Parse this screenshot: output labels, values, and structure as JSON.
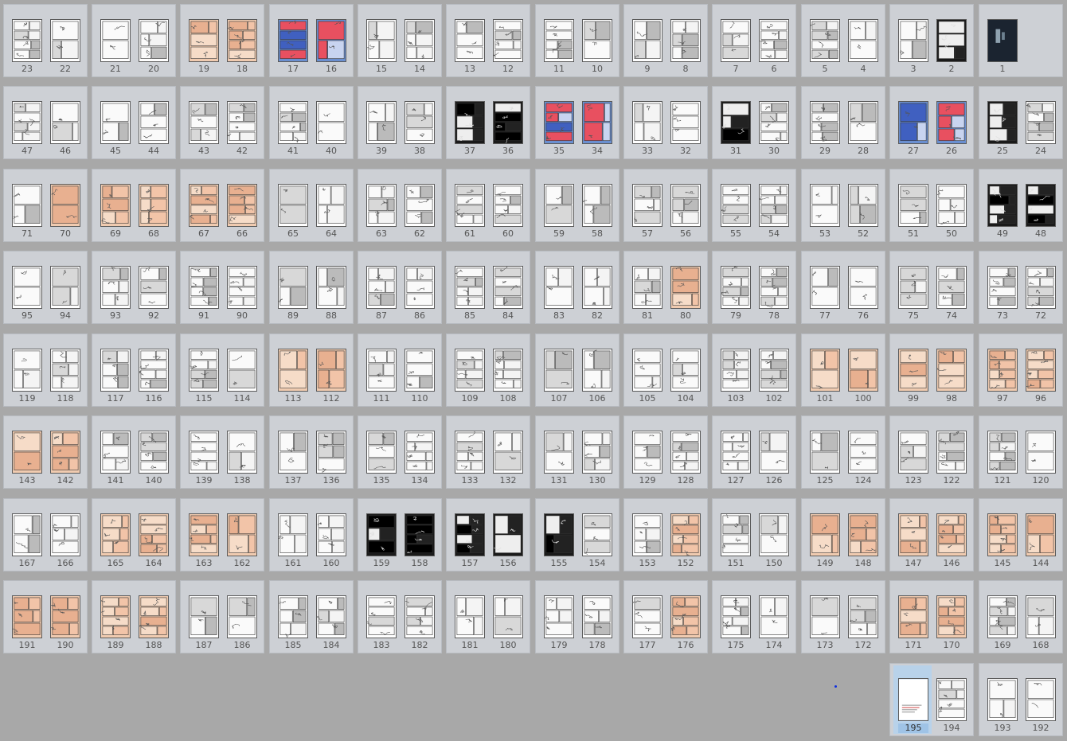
{
  "rows": [
    [
      [
        23,
        22
      ],
      [
        21,
        20
      ],
      [
        19,
        18
      ],
      [
        17,
        16
      ],
      [
        15,
        14
      ],
      [
        13,
        12
      ],
      [
        11,
        10
      ],
      [
        9,
        8
      ],
      [
        7,
        6
      ],
      [
        5,
        4
      ],
      [
        3,
        2
      ],
      [
        1
      ]
    ],
    [
      [
        47,
        46
      ],
      [
        45,
        44
      ],
      [
        43,
        42
      ],
      [
        41,
        40
      ],
      [
        39,
        38
      ],
      [
        37,
        36
      ],
      [
        35,
        34
      ],
      [
        33,
        32
      ],
      [
        31,
        30
      ],
      [
        29,
        28
      ],
      [
        27,
        26
      ],
      [
        25,
        24
      ]
    ],
    [
      [
        71,
        70
      ],
      [
        69,
        68
      ],
      [
        67,
        66
      ],
      [
        65,
        64
      ],
      [
        63,
        62
      ],
      [
        61,
        60
      ],
      [
        59,
        58
      ],
      [
        57,
        56
      ],
      [
        55,
        54
      ],
      [
        53,
        52
      ],
      [
        51,
        50
      ],
      [
        49,
        48
      ]
    ],
    [
      [
        95,
        94
      ],
      [
        93,
        92
      ],
      [
        91,
        90
      ],
      [
        89,
        88
      ],
      [
        87,
        86
      ],
      [
        85,
        84
      ],
      [
        83,
        82
      ],
      [
        81,
        80
      ],
      [
        79,
        78
      ],
      [
        77,
        76
      ],
      [
        75,
        74
      ],
      [
        73,
        72
      ]
    ],
    [
      [
        119,
        118
      ],
      [
        117,
        116
      ],
      [
        115,
        114
      ],
      [
        113,
        112
      ],
      [
        111,
        110
      ],
      [
        109,
        108
      ],
      [
        107,
        106
      ],
      [
        105,
        104
      ],
      [
        103,
        102
      ],
      [
        101,
        100
      ],
      [
        99,
        98
      ],
      [
        97,
        96
      ]
    ],
    [
      [
        143,
        142
      ],
      [
        141,
        140
      ],
      [
        139,
        138
      ],
      [
        137,
        136
      ],
      [
        135,
        134
      ],
      [
        133,
        132
      ],
      [
        131,
        130
      ],
      [
        129,
        128
      ],
      [
        127,
        126
      ],
      [
        125,
        124
      ],
      [
        123,
        122
      ],
      [
        121,
        120
      ]
    ],
    [
      [
        167,
        166
      ],
      [
        165,
        164
      ],
      [
        163,
        162
      ],
      [
        161,
        160
      ],
      [
        159,
        158
      ],
      [
        157,
        156
      ],
      [
        155,
        154
      ],
      [
        153,
        152
      ],
      [
        151,
        150
      ],
      [
        149,
        148
      ],
      [
        147,
        146
      ],
      [
        145,
        144
      ]
    ],
    [
      [
        191,
        190
      ],
      [
        189,
        188
      ],
      [
        187,
        186
      ],
      [
        185,
        184
      ],
      [
        183,
        182
      ],
      [
        181,
        180
      ],
      [
        179,
        178
      ],
      [
        177,
        176
      ],
      [
        175,
        174
      ],
      [
        173,
        172
      ],
      [
        171,
        170
      ],
      [
        169,
        168
      ]
    ],
    [
      null,
      null,
      null,
      null,
      null,
      null,
      null,
      null,
      null,
      null,
      [
        195,
        194
      ],
      [
        193,
        192
      ]
    ]
  ],
  "selected_page": 195,
  "colors": {
    "background": "#a8a8a8",
    "spread_bg": "#cdd0d5",
    "selection": "#b8d2ea",
    "cursor_dot": "#1030e0"
  },
  "page_styles": {
    "dark": [
      1,
      2,
      36,
      37,
      48,
      49,
      158,
      159,
      156,
      157,
      155,
      31,
      25
    ],
    "color_blue": [
      16,
      17,
      26,
      27,
      34,
      35
    ],
    "color_flesh": [
      18,
      19,
      66,
      67,
      68,
      69,
      70,
      96,
      97,
      98,
      99,
      100,
      101,
      112,
      113,
      142,
      143,
      144,
      145,
      146,
      147,
      148,
      149,
      152,
      162,
      163,
      164,
      165,
      170,
      171,
      176,
      188,
      189,
      190,
      191,
      80
    ]
  }
}
